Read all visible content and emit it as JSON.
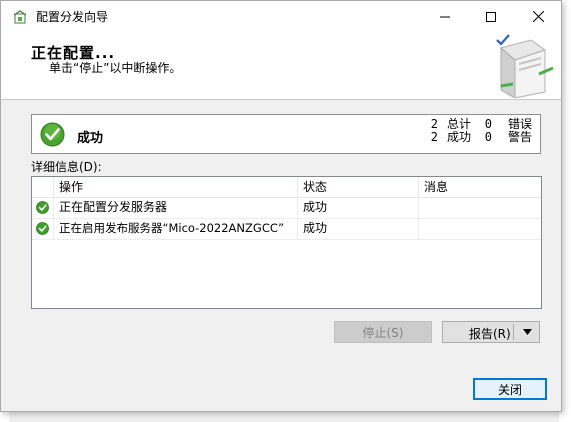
{
  "window": {
    "title": "配置分发向导"
  },
  "caption": {
    "minimize_icon": "minimize-icon",
    "maximize_icon": "maximize-icon",
    "close_icon": "close-icon"
  },
  "header": {
    "title": "正在配置...",
    "subtitle": "单击“停止”以中断操作。"
  },
  "summary": {
    "status": "成功",
    "total_count": "2",
    "total_label": "总计",
    "error_count": "0",
    "error_label": "错误",
    "success_count": "2",
    "success_label": "成功",
    "warning_count": "0",
    "warning_label": "警告"
  },
  "details": {
    "label": "详细信息(D):",
    "columns": [
      "操作",
      "状态",
      "消息"
    ],
    "rows": [
      {
        "action": "正在配置分发服务器",
        "status": "成功",
        "message": ""
      },
      {
        "action": "正在启用发布服务器“Mico-2022ANZGCC”",
        "status": "成功",
        "message": ""
      }
    ]
  },
  "buttons": {
    "stop": "停止(S)",
    "report": "报告(R)",
    "close": "关闭"
  },
  "colors": {
    "accent": "#0078d7",
    "success": "#3a9a2c"
  }
}
